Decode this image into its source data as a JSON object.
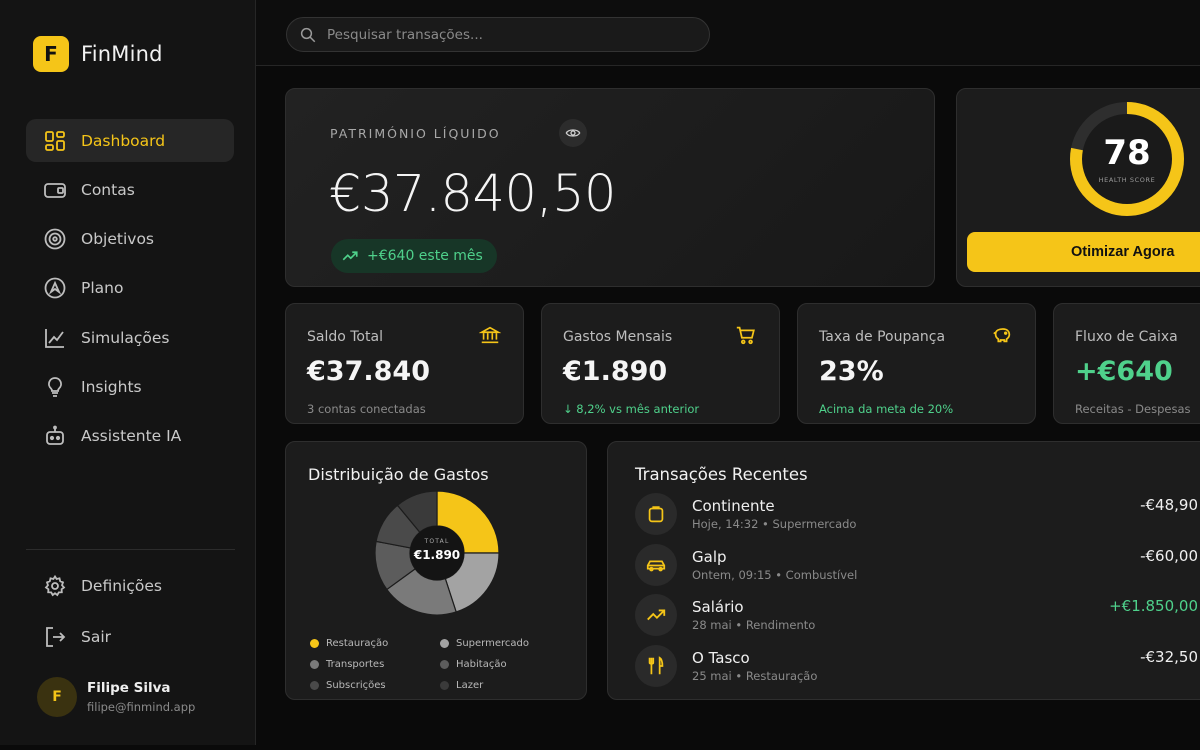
{
  "brand": {
    "logo_letter": "F",
    "name": "FinMind"
  },
  "nav": [
    {
      "label": "Dashboard",
      "icon": "grid-icon",
      "active": true
    },
    {
      "label": "Contas",
      "icon": "wallet-icon"
    },
    {
      "label": "Objetivos",
      "icon": "target-icon"
    },
    {
      "label": "Plano",
      "icon": "compass-icon"
    },
    {
      "label": "Simulações",
      "icon": "chart-line-icon"
    },
    {
      "label": "Insights",
      "icon": "lightbulb-icon"
    },
    {
      "label": "Assistente IA",
      "icon": "robot-icon"
    }
  ],
  "nav_bottom": [
    {
      "label": "Definições",
      "icon": "gear-icon"
    },
    {
      "label": "Sair",
      "icon": "logout-icon"
    }
  ],
  "user": {
    "initial": "F",
    "name": "Filipe Silva",
    "email": "filipe@finmind.app"
  },
  "search": {
    "placeholder": "Pesquisar transações..."
  },
  "net_worth": {
    "label": "PATRIMÓNIO LÍQUIDO",
    "value": "€37.840,50",
    "change": "+€640 este mês"
  },
  "health": {
    "score": "78",
    "label": "HEALTH SCORE",
    "fraction": 0.78,
    "button": "Otimizar Agora"
  },
  "stats": [
    {
      "title": "Saldo Total",
      "value": "€37.840",
      "sub": "3 contas conectadas",
      "icon": "bank-icon"
    },
    {
      "title": "Gastos Mensais",
      "value": "€1.890",
      "sub": "↓ 8,2% vs mês anterior",
      "icon": "cart-icon"
    },
    {
      "title": "Taxa de Poupança",
      "value": "23%",
      "sub": "Acima da meta de 20%",
      "icon": "piggy-bank-icon"
    },
    {
      "title": "Fluxo de Caixa",
      "value": "+€640",
      "sub": "Receitas - Despesas",
      "icon": ""
    }
  ],
  "distribution": {
    "title": "Distribuição de Gastos",
    "total_label": "TOTAL",
    "total_value": "€1.890",
    "segments": [
      {
        "name": "Restauração",
        "value": 25,
        "color": "#f5c518"
      },
      {
        "name": "Supermercado",
        "value": 20,
        "color": "#a3a3a3"
      },
      {
        "name": "Transportes",
        "value": 20,
        "color": "#7a7a7a"
      },
      {
        "name": "Habitação",
        "value": 13,
        "color": "#5c5c5c"
      },
      {
        "name": "Subscrições",
        "value": 11,
        "color": "#4a4a4a"
      },
      {
        "name": "Lazer",
        "value": 11,
        "color": "#3a3a3a"
      }
    ]
  },
  "transactions": {
    "title": "Transações Recentes",
    "items": [
      {
        "name": "Continente",
        "meta": "Hoje, 14:32 • Supermercado",
        "amount": "-€48,90",
        "icon": "shopping-bag-icon",
        "positive": false
      },
      {
        "name": "Galp",
        "meta": "Ontem, 09:15 • Combustível",
        "amount": "-€60,00",
        "icon": "car-icon",
        "positive": false
      },
      {
        "name": "Salário",
        "meta": "28 mai • Rendimento",
        "amount": "+€1.850,00",
        "icon": "trending-up-icon",
        "positive": true
      },
      {
        "name": "O Tasco",
        "meta": "25 mai • Restauração",
        "amount": "-€32,50",
        "icon": "utensils-icon",
        "positive": false
      }
    ]
  },
  "colors": {
    "accent": "#f5c518",
    "positive": "#4fd18b",
    "background": "#0a0a0a"
  }
}
